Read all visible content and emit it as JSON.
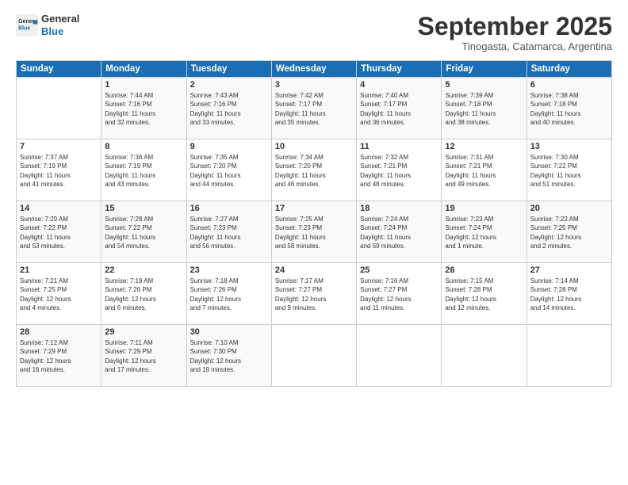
{
  "header": {
    "logo_line1": "General",
    "logo_line2": "Blue",
    "month": "September 2025",
    "location": "Tinogasta, Catamarca, Argentina"
  },
  "days_of_week": [
    "Sunday",
    "Monday",
    "Tuesday",
    "Wednesday",
    "Thursday",
    "Friday",
    "Saturday"
  ],
  "weeks": [
    [
      {
        "day": "",
        "info": ""
      },
      {
        "day": "1",
        "info": "Sunrise: 7:44 AM\nSunset: 7:16 PM\nDaylight: 11 hours\nand 32 minutes."
      },
      {
        "day": "2",
        "info": "Sunrise: 7:43 AM\nSunset: 7:16 PM\nDaylight: 11 hours\nand 33 minutes."
      },
      {
        "day": "3",
        "info": "Sunrise: 7:42 AM\nSunset: 7:17 PM\nDaylight: 11 hours\nand 35 minutes."
      },
      {
        "day": "4",
        "info": "Sunrise: 7:40 AM\nSunset: 7:17 PM\nDaylight: 11 hours\nand 36 minutes."
      },
      {
        "day": "5",
        "info": "Sunrise: 7:39 AM\nSunset: 7:18 PM\nDaylight: 11 hours\nand 38 minutes."
      },
      {
        "day": "6",
        "info": "Sunrise: 7:38 AM\nSunset: 7:18 PM\nDaylight: 11 hours\nand 40 minutes."
      }
    ],
    [
      {
        "day": "7",
        "info": "Sunrise: 7:37 AM\nSunset: 7:19 PM\nDaylight: 11 hours\nand 41 minutes."
      },
      {
        "day": "8",
        "info": "Sunrise: 7:36 AM\nSunset: 7:19 PM\nDaylight: 11 hours\nand 43 minutes."
      },
      {
        "day": "9",
        "info": "Sunrise: 7:35 AM\nSunset: 7:20 PM\nDaylight: 11 hours\nand 44 minutes."
      },
      {
        "day": "10",
        "info": "Sunrise: 7:34 AM\nSunset: 7:20 PM\nDaylight: 11 hours\nand 46 minutes."
      },
      {
        "day": "11",
        "info": "Sunrise: 7:32 AM\nSunset: 7:21 PM\nDaylight: 11 hours\nand 48 minutes."
      },
      {
        "day": "12",
        "info": "Sunrise: 7:31 AM\nSunset: 7:21 PM\nDaylight: 11 hours\nand 49 minutes."
      },
      {
        "day": "13",
        "info": "Sunrise: 7:30 AM\nSunset: 7:22 PM\nDaylight: 11 hours\nand 51 minutes."
      }
    ],
    [
      {
        "day": "14",
        "info": "Sunrise: 7:29 AM\nSunset: 7:22 PM\nDaylight: 11 hours\nand 53 minutes."
      },
      {
        "day": "15",
        "info": "Sunrise: 7:28 AM\nSunset: 7:22 PM\nDaylight: 11 hours\nand 54 minutes."
      },
      {
        "day": "16",
        "info": "Sunrise: 7:27 AM\nSunset: 7:23 PM\nDaylight: 11 hours\nand 56 minutes."
      },
      {
        "day": "17",
        "info": "Sunrise: 7:25 AM\nSunset: 7:23 PM\nDaylight: 11 hours\nand 58 minutes."
      },
      {
        "day": "18",
        "info": "Sunrise: 7:24 AM\nSunset: 7:24 PM\nDaylight: 11 hours\nand 59 minutes."
      },
      {
        "day": "19",
        "info": "Sunrise: 7:23 AM\nSunset: 7:24 PM\nDaylight: 12 hours\nand 1 minute."
      },
      {
        "day": "20",
        "info": "Sunrise: 7:22 AM\nSunset: 7:25 PM\nDaylight: 12 hours\nand 2 minutes."
      }
    ],
    [
      {
        "day": "21",
        "info": "Sunrise: 7:21 AM\nSunset: 7:25 PM\nDaylight: 12 hours\nand 4 minutes."
      },
      {
        "day": "22",
        "info": "Sunrise: 7:19 AM\nSunset: 7:26 PM\nDaylight: 12 hours\nand 6 minutes."
      },
      {
        "day": "23",
        "info": "Sunrise: 7:18 AM\nSunset: 7:26 PM\nDaylight: 12 hours\nand 7 minutes."
      },
      {
        "day": "24",
        "info": "Sunrise: 7:17 AM\nSunset: 7:27 PM\nDaylight: 12 hours\nand 9 minutes."
      },
      {
        "day": "25",
        "info": "Sunrise: 7:16 AM\nSunset: 7:27 PM\nDaylight: 12 hours\nand 11 minutes."
      },
      {
        "day": "26",
        "info": "Sunrise: 7:15 AM\nSunset: 7:28 PM\nDaylight: 12 hours\nand 12 minutes."
      },
      {
        "day": "27",
        "info": "Sunrise: 7:14 AM\nSunset: 7:28 PM\nDaylight: 12 hours\nand 14 minutes."
      }
    ],
    [
      {
        "day": "28",
        "info": "Sunrise: 7:12 AM\nSunset: 7:29 PM\nDaylight: 12 hours\nand 16 minutes."
      },
      {
        "day": "29",
        "info": "Sunrise: 7:11 AM\nSunset: 7:29 PM\nDaylight: 12 hours\nand 17 minutes."
      },
      {
        "day": "30",
        "info": "Sunrise: 7:10 AM\nSunset: 7:30 PM\nDaylight: 12 hours\nand 19 minutes."
      },
      {
        "day": "",
        "info": ""
      },
      {
        "day": "",
        "info": ""
      },
      {
        "day": "",
        "info": ""
      },
      {
        "day": "",
        "info": ""
      }
    ]
  ]
}
